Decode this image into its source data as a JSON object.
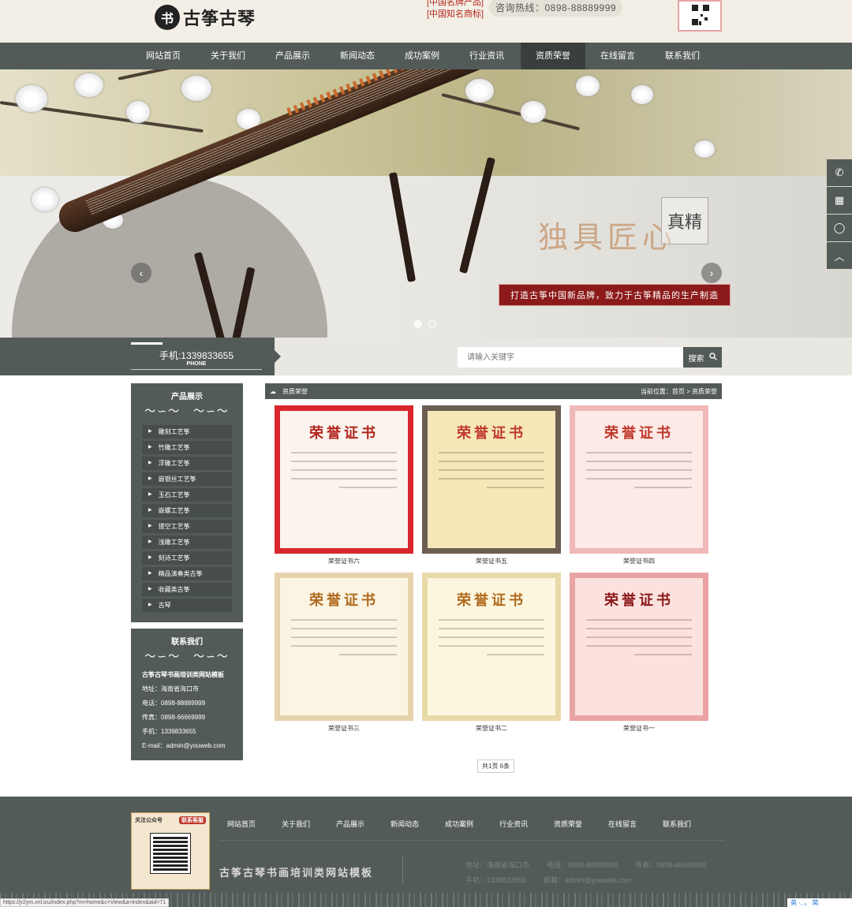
{
  "header": {
    "logo_mark": "书",
    "logo_text": "古筝古琴",
    "brand_tag_1": "[中国名牌产品]",
    "brand_tag_2": "[中国知名商标]",
    "hotline": "咨询热线：0898-88889999"
  },
  "nav": {
    "items": [
      "网站首页",
      "关于我们",
      "产品展示",
      "新闻动态",
      "成功案例",
      "行业资讯",
      "资质荣誉",
      "在线留言",
      "联系我们"
    ],
    "active_index": 6
  },
  "banner": {
    "slogan": "独具匠心",
    "seal": "真精",
    "tagline": "打造古筝中国新品牌，致力于古筝精品的生产制造",
    "prev_icon": "chevron-left-icon",
    "next_icon": "chevron-right-icon",
    "slide_count": 2,
    "active_slide": 0
  },
  "side_float": {
    "icons": [
      "phone-icon",
      "qr-icon",
      "qq-icon",
      "back-to-top-icon"
    ],
    "glyphs": [
      "✆",
      "▦",
      "◯",
      "︿"
    ]
  },
  "strip": {
    "phone": "手机:1339833655",
    "phone_sub": "PHONE",
    "search_placeholder": "请输入关键字",
    "search_label": "搜索"
  },
  "sidebar": {
    "products_title": "产品展示",
    "cloud_glyph": "〜∽〜　〜∽〜",
    "categories": [
      "雕刻工艺筝",
      "竹雕工艺筝",
      "浮雕工艺筝",
      "嵌银丝工艺筝",
      "玉石工艺筝",
      "嵌螺工艺筝",
      "镂空工艺筝",
      "浅雕工艺筝",
      "刻诗工艺筝",
      "精品演奏类古筝",
      "收藏类古筝",
      "古琴"
    ],
    "contact_title": "联系我们",
    "contact_lines": [
      "古筝古琴书画培训类网站模板",
      "地址：海南省海口市",
      "电话：0898-88889999",
      "传真：0898-66669999",
      "手机：1339833655",
      "E-mail：admin@youweb.com"
    ]
  },
  "content": {
    "section_title": "资质荣誉",
    "breadcrumb": "当前位置：首页 > 资质荣誉",
    "certificates": [
      {
        "title": "荣誉证书",
        "caption": "荣誉证书六",
        "frame": "#d9262e",
        "paper": "#fbf3ee",
        "ink": "#b3261e"
      },
      {
        "title": "荣誉证书",
        "caption": "荣誉证书五",
        "frame": "#6b5e52",
        "paper": "#f6e7b8",
        "ink": "#c0392b"
      },
      {
        "title": "荣誉证书",
        "caption": "荣誉证书四",
        "frame": "#f0b8b8",
        "paper": "#fde9e6",
        "ink": "#c0392b"
      },
      {
        "title": "荣誉证书",
        "caption": "荣誉证书三",
        "frame": "#e6d3ae",
        "paper": "#fbf4e3",
        "ink": "#b06b1e"
      },
      {
        "title": "荣誉证书",
        "caption": "荣誉证书二",
        "frame": "#e8d9a8",
        "paper": "#fcf6df",
        "ink": "#b06b1e"
      },
      {
        "title": "荣誉证书",
        "caption": "荣誉证书一",
        "frame": "#e9a3a3",
        "paper": "#fbe2de",
        "ink": "#8c1a1a"
      }
    ],
    "pager": "共1页 6条"
  },
  "footer": {
    "qr_left": "关注公众号",
    "qr_right": "联系客服",
    "nav": [
      "网站首页",
      "关于我们",
      "产品展示",
      "新闻动态",
      "成功案例",
      "行业资讯",
      "资质荣誉",
      "在线留言",
      "联系我们"
    ],
    "slogan": "古筝古琴书画培训类网站模板",
    "address": "地址：海南省海口市",
    "tel": "电话：0898-88889999",
    "fax": "传真：0898-66669999",
    "mobile": "手机：1339833655",
    "email": "邮箱：admin@youweb.com"
  },
  "status_url": "https://jr2ym.xnl.icu/index.php?m=home&c=View&a=index&aid=71",
  "ime": "英 ·, 。 简"
}
